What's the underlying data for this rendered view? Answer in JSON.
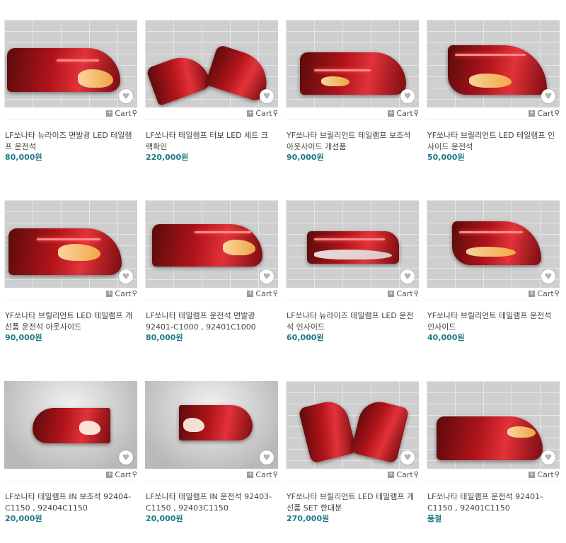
{
  "cart_label": "Cart",
  "products": [
    {
      "title": "LF쏘나타 뉴라이즈 면발광 LED 테일램프 운전석",
      "price": "80,000원"
    },
    {
      "title": "LF쏘나타 테일램프 터보 LED 세트 크랙확인",
      "price": "220,000원"
    },
    {
      "title": "YF쏘나타 브릴리언트 테일램프 보조석 아웃사이드 개선품",
      "price": "90,000원"
    },
    {
      "title": "YF쏘나타 브릴리언트 LED 테일램프 인사이드 운전석",
      "price": "50,000원"
    },
    {
      "title": "YF쏘나타 브릴리언트 LED 테일램프 개선품 운전석 아웃사이드",
      "price": "90,000원"
    },
    {
      "title": "LF쏘나타 테일램프 운전석 면발광 92401-C1000 , 92401C1000",
      "price": "80,000원"
    },
    {
      "title": "LF쏘나타 뉴라이즈 테일램프 LED 운전석 인사이드",
      "price": "60,000원"
    },
    {
      "title": "YF쏘나타 브릴리언트 테일램프 운전석 인사이드",
      "price": "40,000원"
    },
    {
      "title": "LF쏘나타 테일램프 IN 보조석 92404-C1150 , 92404C1150",
      "price": "20,000원"
    },
    {
      "title": "LF쏘나타 테일램프 IN 운전석 92403-C1150 , 92403C1150",
      "price": "20,000원"
    },
    {
      "title": "YF쏘나타 브릴리언트 LED 테일램프 개선품 SET 한대분",
      "price": "270,000원"
    },
    {
      "title": "LF쏘나타 테일램프 운전석 92401-C1150 , 92401C1150",
      "price": "품절"
    }
  ]
}
